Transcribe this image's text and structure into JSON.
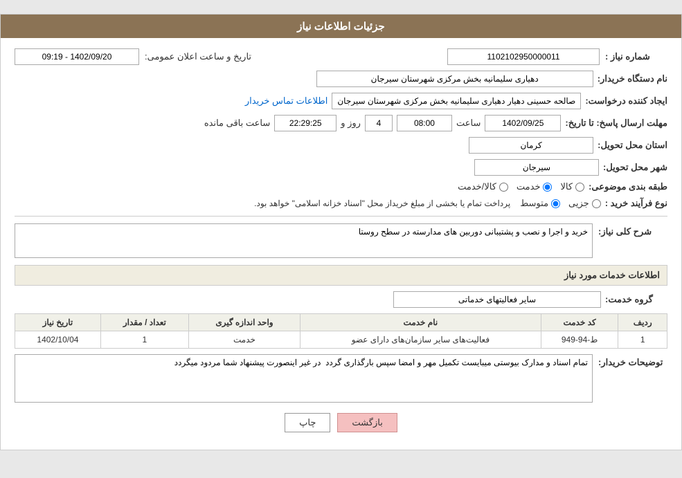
{
  "header": {
    "title": "جزئیات اطلاعات نیاز"
  },
  "fields": {
    "shomara_niaz_label": "شماره نیاز :",
    "shomara_niaz_value": "1102102950000011",
    "name_dastgah_label": "نام دستگاه خریدار:",
    "name_dastgah_value": "دهیاری سلیمانیه بخش مرکزی شهرستان سیرجان",
    "ijad_konande_label": "ایجاد کننده درخواست:",
    "ijad_konande_value": "صالحه حسینی دهیار دهیاری سلیمانیه بخش مرکزی شهرستان سیرجان",
    "ettelaat_tamas_label": "اطلاعات تماس خریدار",
    "mohlat_label": "مهلت ارسال پاسخ: تا تاریخ:",
    "date_value": "1402/09/25",
    "saat_label": "ساعت",
    "saat_value": "08:00",
    "rooz_label": "روز و",
    "rooz_value": "4",
    "baqi_saat_label": "ساعت باقی مانده",
    "baqi_saat_value": "22:29:25",
    "tarikh_label": "تاریخ و ساعت اعلان عمومی:",
    "tarikh_value": "1402/09/20 - 09:19",
    "ostan_label": "استان محل تحویل:",
    "ostan_value": "کرمان",
    "shahr_label": "شهر محل تحویل:",
    "shahr_value": "سیرجان",
    "tabaqe_label": "طبقه بندی موضوعی:",
    "tabaqe_kala": "کالا",
    "tabaqe_khadamat": "خدمت",
    "tabaqe_kala_khadamat": "کالا/خدمت",
    "tabaqe_selected": "خدمت",
    "nooe_farayand_label": "نوع فرآیند خرید :",
    "jozii": "جزیی",
    "motavasset": "متوسط",
    "notice": "پرداخت تمام یا بخشی از مبلغ خریداز محل \"اسناد خزانه اسلامی\" خواهد بود.",
    "sharh_label": "شرح کلی نیاز:",
    "sharh_value": "خرید و اجرا و نصب و پشتیبانی دوربین های مدارسته در سطح روستا",
    "services_header": "اطلاعات خدمات مورد نیاز",
    "gorooh_label": "گروه خدمت:",
    "gorooh_value": "سایر فعالیتهای خدماتی",
    "table": {
      "headers": [
        "ردیف",
        "کد خدمت",
        "نام خدمت",
        "واحد اندازه گیری",
        "تعداد / مقدار",
        "تاریخ نیاز"
      ],
      "rows": [
        {
          "radif": "1",
          "code": "ط-94-949",
          "name": "فعالیت‌های سایر سازمان‌های دارای عضو",
          "unit": "خدمت",
          "count": "1",
          "date": "1402/10/04"
        }
      ]
    },
    "tawsiyat_label": "توضیحات خریدار:",
    "tawsiyat_value": "تمام اسناد و مدارک بیوستی میبایست تکمیل مهر و امضا سپس بارگذاری گردد  در غیر اینصورت پیشنهاد شما مردود میگردد"
  },
  "buttons": {
    "print_label": "چاپ",
    "back_label": "بازگشت"
  }
}
